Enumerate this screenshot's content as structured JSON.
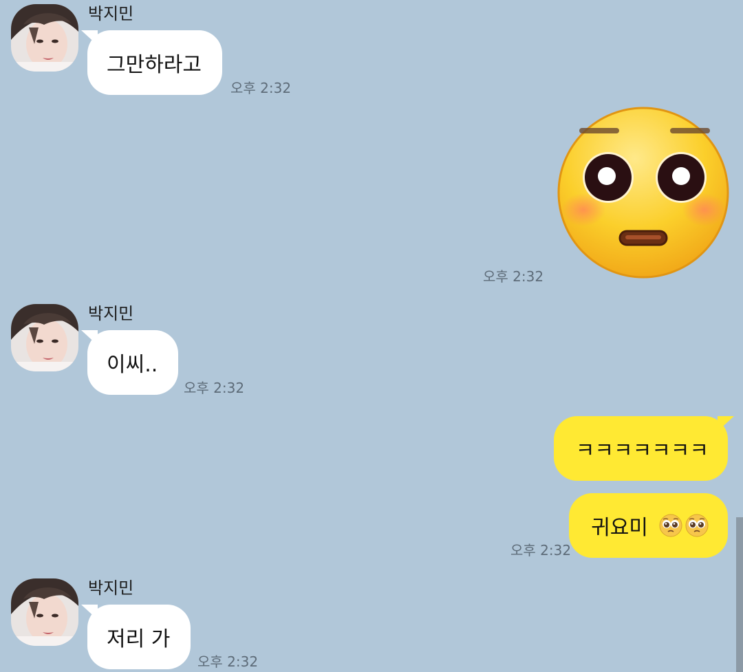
{
  "chat": {
    "messages": [
      {
        "sender": "박지민",
        "text": "그만하라고",
        "time": "오후 2:32"
      },
      {
        "sticker": "flushed-face-sticker",
        "time": "오후 2:32"
      },
      {
        "sender": "박지민",
        "text": "이씨..",
        "time": "오후 2:32"
      },
      {
        "text": "ㅋㅋㅋㅋㅋㅋㅋ"
      },
      {
        "text": "귀요미",
        "emoji": "pleading-face-icon",
        "time": "오후 2:32"
      },
      {
        "sender": "박지민",
        "text": "저리 가",
        "time": "오후 2:32"
      }
    ]
  },
  "colors": {
    "background": "#b1c7d9",
    "incoming_bubble": "#ffffff",
    "outgoing_bubble": "#ffe933",
    "timestamp": "#5d6b78"
  }
}
